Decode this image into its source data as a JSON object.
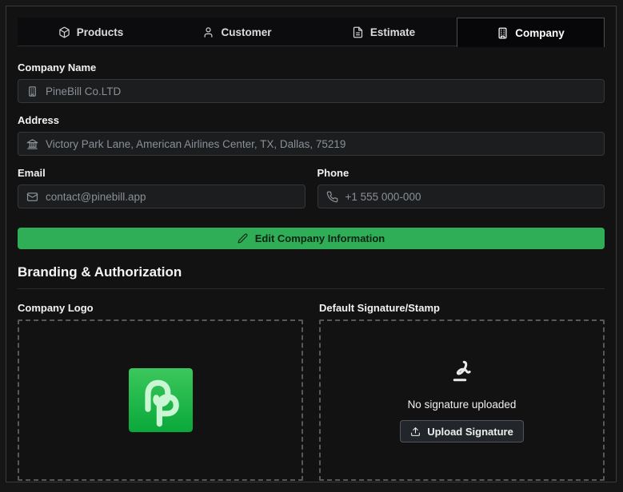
{
  "tabs": [
    {
      "label": "Products",
      "icon": "package-icon",
      "active": false
    },
    {
      "label": "Customer",
      "icon": "user-icon",
      "active": false
    },
    {
      "label": "Estimate",
      "icon": "file-text-icon",
      "active": false
    },
    {
      "label": "Company",
      "icon": "building-icon",
      "active": true
    }
  ],
  "form": {
    "company_name": {
      "label": "Company Name",
      "placeholder": "PineBill Co.LTD"
    },
    "address": {
      "label": "Address",
      "placeholder": "Victory Park Lane, American Airlines Center, TX, Dallas, 75219"
    },
    "email": {
      "label": "Email",
      "placeholder": "contact@pinebill.app"
    },
    "phone": {
      "label": "Phone",
      "placeholder": "+1 555 000-000"
    },
    "edit_button_label": "Edit Company Information"
  },
  "branding": {
    "section_title": "Branding & Authorization",
    "logo_label": "Company Logo",
    "signature_label": "Default Signature/Stamp",
    "no_signature_text": "No signature uploaded",
    "upload_button_label": "Upload Signature"
  },
  "colors": {
    "accent_green": "#2fae57",
    "logo_gradient_top": "#3cc75c",
    "logo_gradient_bottom": "#0aa83a",
    "logo_glyph": "#c9f6d3"
  }
}
